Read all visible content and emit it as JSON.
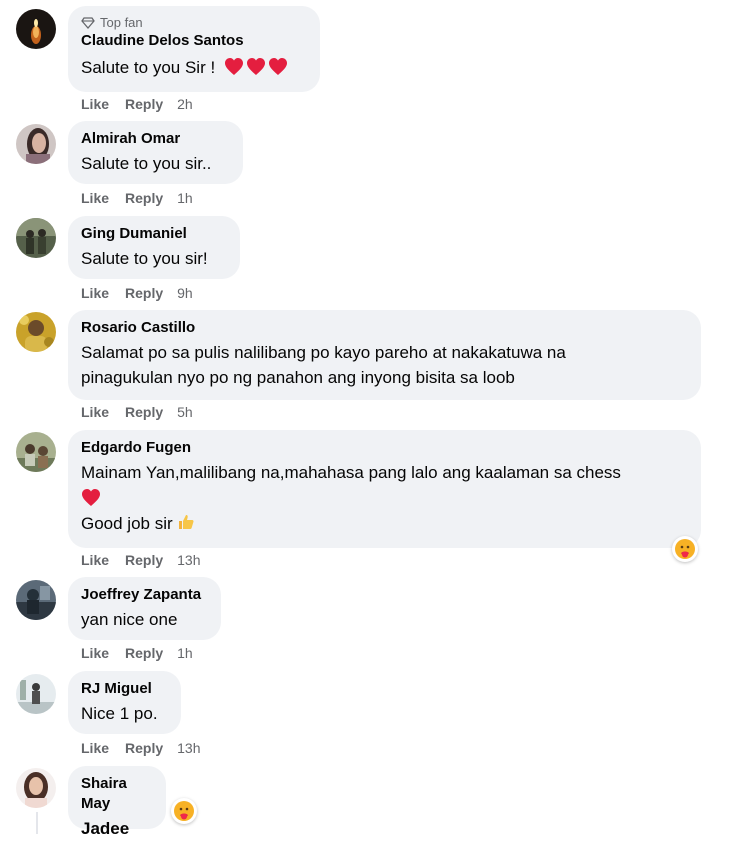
{
  "comments": [
    {
      "name": "Claudine Delos Santos",
      "badge": "Top fan",
      "text": "Salute to you Sir !",
      "emoji": "heart-icons",
      "like": "Like",
      "reply": "Reply",
      "time": "2h"
    },
    {
      "name": "Almirah Omar",
      "text": "Salute to you sir..",
      "like": "Like",
      "reply": "Reply",
      "time": "1h"
    },
    {
      "name": "Ging Dumaniel",
      "text": "Salute to you sir!",
      "like": "Like",
      "reply": "Reply",
      "time": "9h"
    },
    {
      "name": "Rosario Castillo",
      "text_line1": "Salamat po sa pulis nalilibang po kayo pareho at nakakatuwa na",
      "text_line2": "pinagukulan nyo po ng panahon ang inyong bisita sa loob",
      "like": "Like",
      "reply": "Reply",
      "time": "5h"
    },
    {
      "name": "Edgardo Fugen",
      "text_line1": "Mainam Yan,malilibang na,mahahasa pang lalo ang kaalaman sa chess",
      "text_line3": "Good job sir",
      "like": "Like",
      "reply": "Reply",
      "time": "13h"
    },
    {
      "name": "Joeffrey Zapanta",
      "text": "yan nice one",
      "like": "Like",
      "reply": "Reply",
      "time": "1h"
    },
    {
      "name": "RJ Miguel",
      "text": "Nice 1 po.",
      "like": "Like",
      "reply": "Reply",
      "time": "13h"
    },
    {
      "name": "Shaira May",
      "text": "Jadee"
    }
  ],
  "colors": {
    "bubble": "#f0f2f5",
    "meta": "#65676b",
    "heart": "#e41e3f"
  }
}
